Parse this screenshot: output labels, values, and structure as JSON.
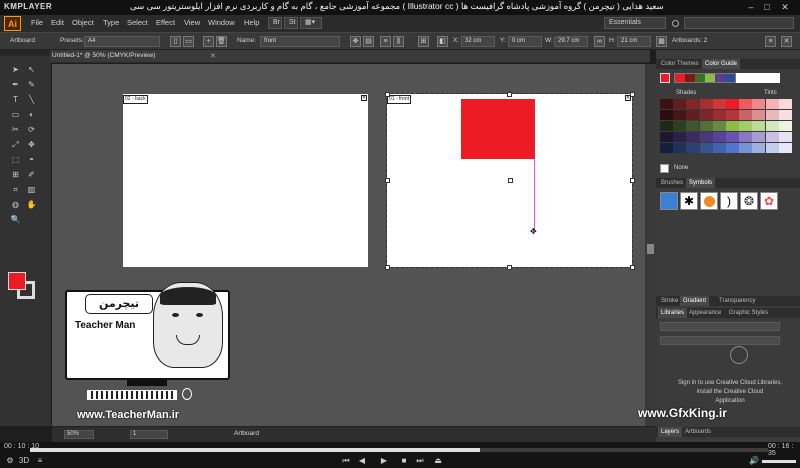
{
  "player": {
    "name": "KMPLAYER",
    "title": "مجموعه آموزشی جامع ، گام به گام و کاربردی نرم افزار ایلوستریتور سی سی ( Illustrator cc ) مدرس : سعید هدایی ( تیچرمن ) گروه آموزشی پادشاه گرافیست ها",
    "time_elapsed": "00 : 10 : 10",
    "time_total": "00 : 16 : 35",
    "progress": 0.61
  },
  "app": {
    "logo": "Ai",
    "menus": [
      "File",
      "Edit",
      "Object",
      "Type",
      "Select",
      "Effect",
      "View",
      "Window",
      "Help"
    ],
    "workspace": "Essentials",
    "search_icon": "search-icon"
  },
  "control_bar": {
    "mode": "Artboard",
    "presets_label": "Presets:",
    "preset_value": "A4",
    "name_label": "Name:",
    "name_value": "front",
    "x_label": "X:",
    "x_value": "32 cm",
    "y_label": "Y:",
    "y_value": "0 cm",
    "w_label": "W:",
    "w_value": "29.7 cm",
    "h_label": "H:",
    "h_value": "21 cm",
    "artboards_label": "Artboards: 2"
  },
  "document": {
    "tab_title": "Untitled-1* @ 50% (CMYK/Preview)",
    "artboards": [
      {
        "label": "02 - back"
      },
      {
        "label": "01 - front"
      }
    ],
    "fill_color": "#ed1c24",
    "path_color": "#e64ee6"
  },
  "panels": {
    "color_tabs": [
      "Color Themes",
      "Color Guide"
    ],
    "shades_label": "Shades",
    "tints_label": "Tints",
    "none_label": "None",
    "brush_tabs": [
      "Brushes",
      "Symbols"
    ],
    "stroke_tabs": [
      "Stroke",
      "Gradient",
      "Transparency"
    ],
    "lib_tabs": [
      "Libraries",
      "Appearance",
      "Graphic Styles"
    ],
    "lib_message_1": "Sign in to use Creative Cloud Libraries,",
    "lib_message_2": "install the Creative Cloud",
    "lib_message_3": "Application",
    "layers_tabs": [
      "Layers",
      "Artboards"
    ]
  },
  "status_bar": {
    "zoom": "50%",
    "artboard_num": "1",
    "tool_name": "Artboard"
  },
  "watermarks": {
    "left_url": "www.TeacherMan.ir",
    "left_brand": "Teacher Man",
    "right_url": "www.GfxKing.ir"
  }
}
